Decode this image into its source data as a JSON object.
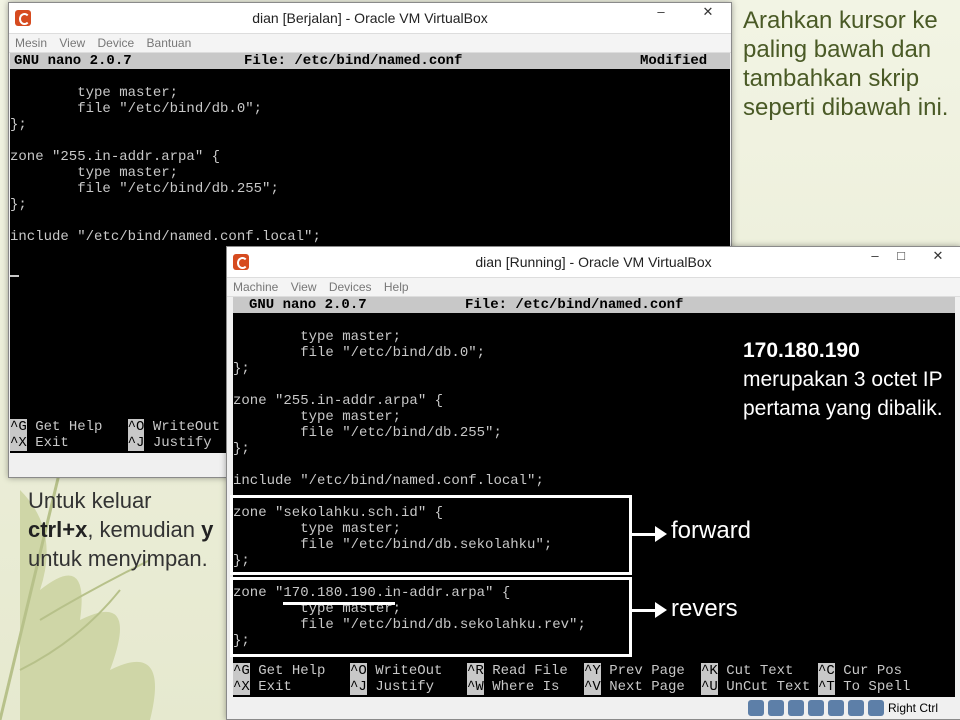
{
  "captions": {
    "top": "Arahkan kursor ke paling bawah dan tambahkan skrip seperti dibawah ini.",
    "left_prefix": "Untuk keluar ",
    "left_key1": "ctrl+x",
    "left_mid": ", kemudian ",
    "left_key2": "y",
    "left_suffix": " untuk menyimpan."
  },
  "win1": {
    "title": "dian [Berjalan] - Oracle VM VirtualBox",
    "menu": [
      "Mesin",
      "View",
      "Device",
      "Bantuan"
    ],
    "nano_version": "GNU nano 2.0.7",
    "nano_file": "File: /etc/bind/named.conf",
    "nano_status": "Modified",
    "lines": [
      "        type master;",
      "        file \"/etc/bind/db.0\";",
      "};",
      "",
      "zone \"255.in-addr.arpa\" {",
      "        type master;",
      "        file \"/etc/bind/db.255\";",
      "};",
      "",
      "include \"/etc/bind/named.conf.local\";"
    ],
    "shortcuts_row1": [
      {
        "k": "^G",
        "t": "Get Help"
      },
      {
        "k": "^O",
        "t": "WriteOut"
      }
    ],
    "shortcuts_row2": [
      {
        "k": "^X",
        "t": "Exit"
      },
      {
        "k": "^J",
        "t": "Justify"
      }
    ]
  },
  "win2": {
    "title": "dian [Running] - Oracle VM VirtualBox",
    "menu": [
      "Machine",
      "View",
      "Devices",
      "Help"
    ],
    "nano_version": "GNU nano 2.0.7",
    "nano_file": "File: /etc/bind/named.conf",
    "lines": [
      "        type master;",
      "        file \"/etc/bind/db.0\";",
      "};",
      "",
      "zone \"255.in-addr.arpa\" {",
      "        type master;",
      "        file \"/etc/bind/db.255\";",
      "};",
      "",
      "include \"/etc/bind/named.conf.local\";",
      "",
      "zone \"sekolahku.sch.id\" {",
      "        type master;",
      "        file \"/etc/bind/db.sekolahku\";",
      "};",
      "",
      "zone \"170.180.190.in-addr.arpa\" {",
      "        type master;",
      "        file \"/etc/bind/db.sekolahku.rev\";",
      "};"
    ],
    "shortcuts_row1": [
      {
        "k": "^G",
        "t": "Get Help"
      },
      {
        "k": "^O",
        "t": "WriteOut"
      },
      {
        "k": "^R",
        "t": "Read File"
      },
      {
        "k": "^Y",
        "t": "Prev Page"
      },
      {
        "k": "^K",
        "t": "Cut Text"
      },
      {
        "k": "^C",
        "t": "Cur Pos"
      }
    ],
    "shortcuts_row2": [
      {
        "k": "^X",
        "t": "Exit"
      },
      {
        "k": "^J",
        "t": "Justify"
      },
      {
        "k": "^W",
        "t": "Where Is"
      },
      {
        "k": "^V",
        "t": "Next Page"
      },
      {
        "k": "^U",
        "t": "UnCut Text"
      },
      {
        "k": "^T",
        "t": "To Spell"
      }
    ],
    "host_key": "Right Ctrl"
  },
  "annotations": {
    "ip": "170.180.190",
    "ip_note": "merupakan 3 octet IP pertama yang dibalik.",
    "forward": "forward",
    "reverse": "revers"
  },
  "window_controls": {
    "minimize": "–",
    "restore": "□",
    "close": "✕"
  }
}
